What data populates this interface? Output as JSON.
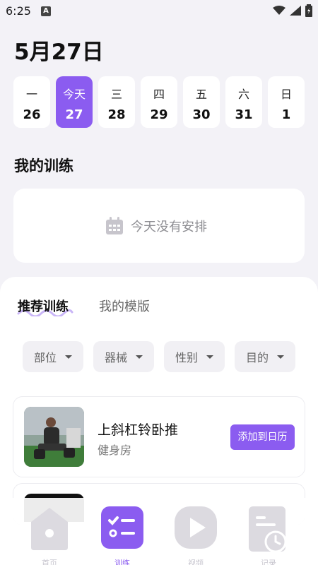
{
  "status": {
    "time": "6:25",
    "notif_badge": "A"
  },
  "header": {
    "date": "5月27日"
  },
  "week": [
    {
      "label": "一",
      "num": "26",
      "active": false
    },
    {
      "label": "今天",
      "num": "27",
      "active": true
    },
    {
      "label": "三",
      "num": "28",
      "active": false
    },
    {
      "label": "四",
      "num": "29",
      "active": false
    },
    {
      "label": "五",
      "num": "30",
      "active": false
    },
    {
      "label": "六",
      "num": "31",
      "active": false
    },
    {
      "label": "日",
      "num": "1",
      "active": false
    }
  ],
  "my_training": {
    "title": "我的训练",
    "empty_text": "今天没有安排"
  },
  "tabs": {
    "recommended": "推荐训练",
    "templates": "我的模版"
  },
  "filters": [
    "部位",
    "器械",
    "性别",
    "目的"
  ],
  "workouts": [
    {
      "title": "上斜杠铃卧推",
      "subtitle": "健身房",
      "button": "添加到日历"
    }
  ],
  "colors": {
    "accent": "#8b5cf0",
    "background": "#f3f2f7",
    "nav_inactive": "#dcdae0"
  },
  "nav": [
    {
      "icon": "home-icon",
      "active": false
    },
    {
      "icon": "plan-list-icon",
      "active": true
    },
    {
      "icon": "video-play-icon",
      "active": false
    },
    {
      "icon": "history-report-icon",
      "active": false
    }
  ]
}
